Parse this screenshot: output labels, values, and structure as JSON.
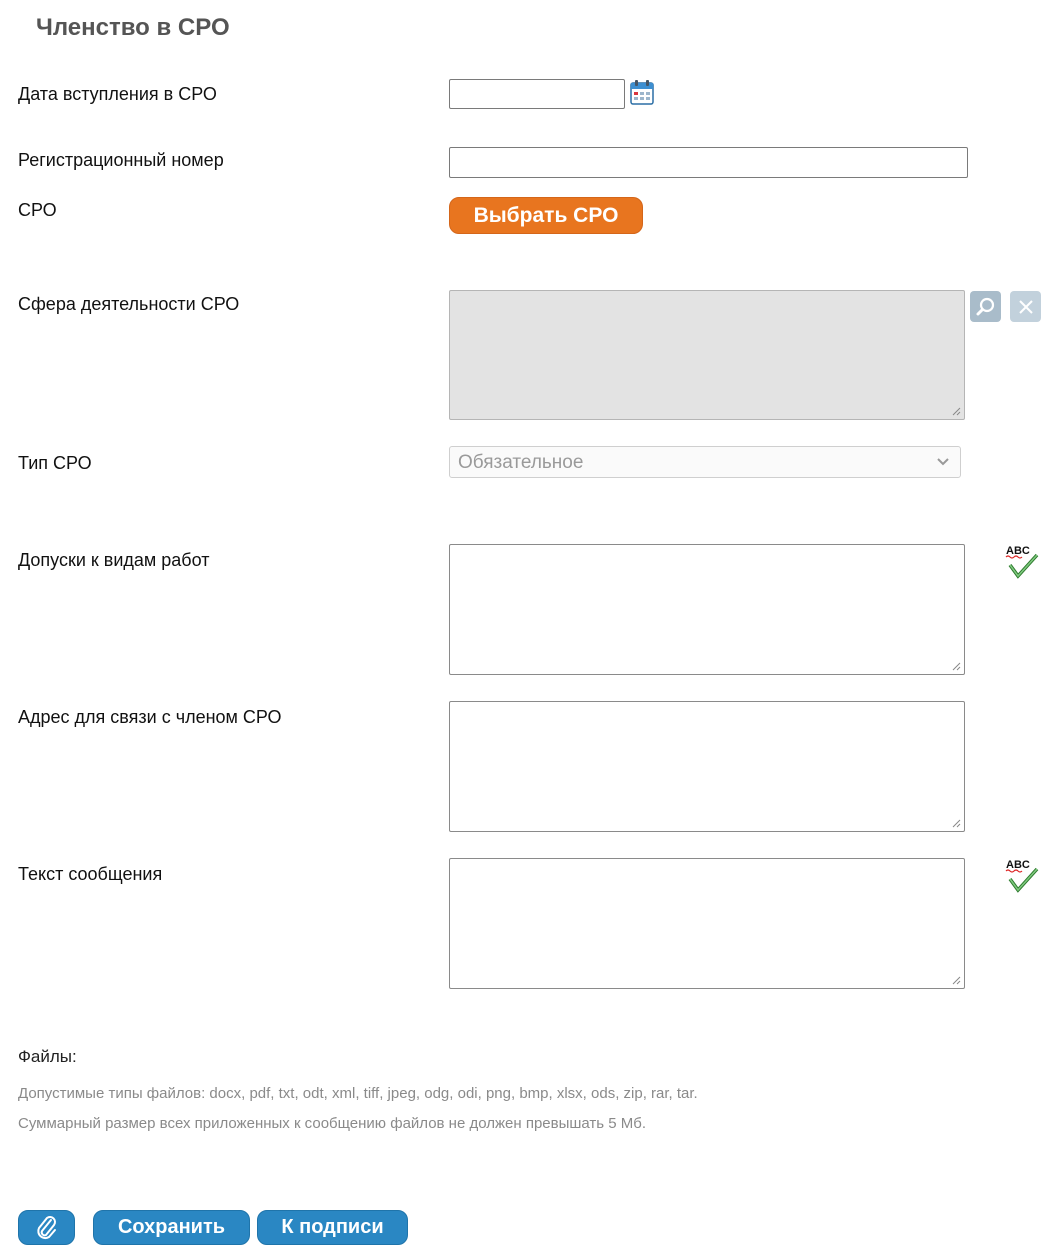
{
  "section_title": "Членство в СРО",
  "fields": {
    "join_date": {
      "label": "Дата вступления в СРО",
      "value": ""
    },
    "reg_number": {
      "label": "Регистрационный номер",
      "value": ""
    },
    "sro": {
      "label": "СРО",
      "button": "Выбрать СРО"
    },
    "activity": {
      "label": "Сфера деятельности СРО",
      "value": ""
    },
    "type": {
      "label": "Тип СРО",
      "selected": "Обязательное"
    },
    "permits": {
      "label": "Допуски к видам работ",
      "value": ""
    },
    "address": {
      "label": "Адрес для связи с членом СРО",
      "value": ""
    },
    "message": {
      "label": "Текст сообщения",
      "value": ""
    }
  },
  "spellcheck_label": "ABC",
  "files": {
    "label": "Файлы:",
    "allowed_types": "Допустимые типы файлов: docx, pdf, txt, odt, xml, tiff, jpeg, odg, odi, png, bmp, xlsx, ods, zip, rar, tar.",
    "size_limit": "Суммарный размер всех приложенных к сообщению файлов не должен превышать 5 Мб."
  },
  "actions": {
    "save": "Сохранить",
    "sign": "К подписи"
  },
  "icons": {
    "calendar": "calendar-icon",
    "search": "magnifier-icon",
    "clear": "close-icon",
    "spellcheck": "spellcheck-icon",
    "attach": "paperclip-icon",
    "dropdown": "chevron-down-icon"
  },
  "colors": {
    "orange_button": "#e8751f",
    "blue_button": "#2a87c3",
    "title": "#555555"
  }
}
